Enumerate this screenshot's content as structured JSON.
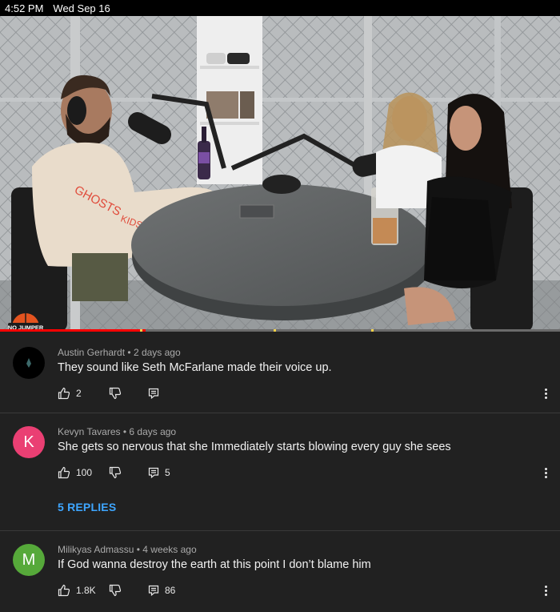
{
  "status_bar": {
    "time": "4:52 PM",
    "date": "Wed Sep 16"
  },
  "video": {
    "progress_fraction": 0.26,
    "logo_text": "NO JUMPER"
  },
  "comments": [
    {
      "author": "Austin Gerhardt",
      "age": "2 days ago",
      "text": "They sound like Seth McFarlane made their voice up.",
      "likes": "2",
      "replies_count": "",
      "avatar_letter": "",
      "avatar_color": "#000000"
    },
    {
      "author": "Kevyn Tavares",
      "age": "6 days ago",
      "text": "She gets so nervous that she Immediately starts blowing every guy she sees",
      "likes": "100",
      "replies_count": "5",
      "avatar_letter": "K",
      "avatar_color": "#ea3f73",
      "view_replies": "5 REPLIES"
    },
    {
      "author": "Milikyas Admassu",
      "age": "4 weeks ago",
      "text": "If God wanna destroy the earth at this point I don’t blame him",
      "likes": "1.8K",
      "replies_count": "86",
      "avatar_letter": "M",
      "avatar_color": "#56a93a"
    }
  ],
  "separator": "•",
  "colors": {
    "accent_link": "#3ea6ff",
    "progress": "#ff0000",
    "background": "#212121"
  }
}
